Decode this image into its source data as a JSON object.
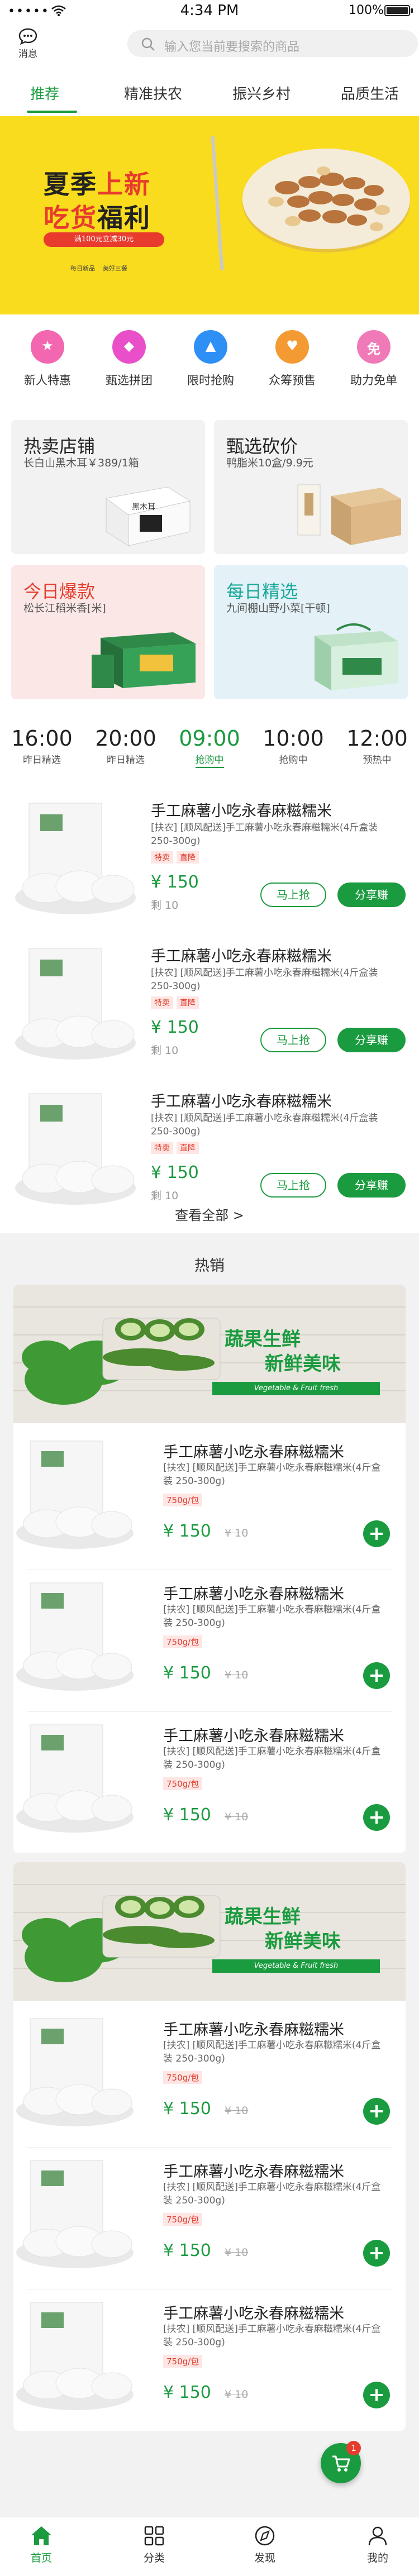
{
  "status_bar": {
    "carrier": "•••••",
    "time": "4:34 PM",
    "battery": "100%"
  },
  "header": {
    "message_label": "消息",
    "search_placeholder": "输入您当前要搜索的商品"
  },
  "tabs": [
    {
      "label": "推荐",
      "active": true
    },
    {
      "label": "精准扶农",
      "active": false
    },
    {
      "label": "振兴乡村",
      "active": false
    },
    {
      "label": "品质生活",
      "active": false
    }
  ],
  "banner": {
    "line1_a": "夏季",
    "line1_b": "上新",
    "line2_a": "吃货",
    "line2_b": "福利",
    "pill": "满100元立减30元",
    "foot_a": "每日新品",
    "foot_b": "美好三餐"
  },
  "quick_icons": [
    {
      "label": "新人特惠",
      "glyph": "🎁",
      "color": "#f267b0",
      "icon": "gift-icon"
    },
    {
      "label": "甄选拼团",
      "glyph": "🛍",
      "color": "#e84fc9",
      "icon": "shopping-bag-icon"
    },
    {
      "label": "限时抢购",
      "glyph": "🔥",
      "color": "#2e8ff5",
      "icon": "fire-icon"
    },
    {
      "label": "众筹预售",
      "glyph": "♥",
      "color": "#f39a33",
      "icon": "heart-hand-icon"
    },
    {
      "label": "助力免单",
      "glyph": "免",
      "color": "#f07ab7",
      "icon": "free-order-icon"
    }
  ],
  "promo_cards": [
    {
      "title": "热卖店铺",
      "subtitle": "长白山黑木耳￥389/1箱",
      "bg": "#f2f2f2"
    },
    {
      "title": "甄选砍价",
      "subtitle": "鸭脂米10盒/9.9元",
      "bg": "#f2f2f2"
    },
    {
      "title": "今日爆款",
      "subtitle": "松长江稻米香[米]",
      "bg": "#fbe8e6"
    },
    {
      "title": "每日精选",
      "subtitle": "九间棚山野小菜[干顿]",
      "bg": "#e4f2f7"
    }
  ],
  "flash_slots": [
    {
      "time": "16:00",
      "status": "昨日精选",
      "active": false
    },
    {
      "time": "20:00",
      "status": "昨日精选",
      "active": false
    },
    {
      "time": "09:00",
      "status": "抢购中",
      "active": true
    },
    {
      "time": "10:00",
      "status": "抢购中",
      "active": false
    },
    {
      "time": "12:00",
      "status": "预热中",
      "active": false
    }
  ],
  "flash_items": [
    {
      "name": "手工麻薯小吃永春麻糍糯米",
      "desc": "[扶农] [顺风配送]手工麻薯小吃永春麻糍糯米(4斤盒装 250-300g)",
      "tags": [
        "特卖",
        "直降"
      ],
      "price": "¥ 150",
      "remaining": "剩 10"
    },
    {
      "name": "手工麻薯小吃永春麻糍糯米",
      "desc": "[扶农] [顺风配送]手工麻薯小吃永春麻糍糯米(4斤盒装 250-300g)",
      "tags": [
        "特卖",
        "直降"
      ],
      "price": "¥ 150",
      "remaining": "剩 10"
    },
    {
      "name": "手工麻薯小吃永春麻糍糯米",
      "desc": "[扶农] [顺风配送]手工麻薯小吃永春麻糍糯米(4斤盒装 250-300g)",
      "tags": [
        "特卖",
        "直降"
      ],
      "price": "¥ 150",
      "remaining": "剩 10"
    }
  ],
  "buttons": {
    "grab": "马上抢",
    "share": "分享赚",
    "view_all": "查看全部 >"
  },
  "hot": {
    "title": "热销",
    "fresh_line1": "蔬果生鲜",
    "fresh_line2": "新鲜美味",
    "fresh_en": "Vegetable & Fruit fresh",
    "items": [
      {
        "name": "手工麻薯小吃永春麻糍糯米",
        "desc": "[扶农] [顺风配送]手工麻薯小吃永春麻糍糯米(4斤盒装 250-300g)",
        "unit": "750g/包",
        "price": "¥ 150",
        "old": "¥ 10"
      },
      {
        "name": "手工麻薯小吃永春麻糍糯米",
        "desc": "[扶农] [顺风配送]手工麻薯小吃永春麻糍糯米(4斤盒装 250-300g)",
        "unit": "750g/包",
        "price": "¥ 150",
        "old": "¥ 10"
      },
      {
        "name": "手工麻薯小吃永春麻糍糯米",
        "desc": "[扶农] [顺风配送]手工麻薯小吃永春麻糍糯米(4斤盒装 250-300g)",
        "unit": "750g/包",
        "price": "¥ 150",
        "old": "¥ 10"
      },
      {
        "name": "手工麻薯小吃永春麻糍糯米",
        "desc": "[扶农] [顺风配送]手工麻薯小吃永春麻糍糯米(4斤盒装 250-300g)",
        "unit": "750g/包",
        "price": "¥ 150",
        "old": "¥ 10"
      },
      {
        "name": "手工麻薯小吃永春麻糍糯米",
        "desc": "[扶农] [顺风配送]手工麻薯小吃永春麻糍糯米(4斤盒装 250-300g)",
        "unit": "750g/包",
        "price": "¥ 150",
        "old": "¥ 10"
      },
      {
        "name": "手工麻薯小吃永春麻糍糯米",
        "desc": "[扶农] [顺风配送]手工麻薯小吃永春麻糍糯米(4斤盒装 250-300g)",
        "unit": "750g/包",
        "price": "¥ 150",
        "old": "¥ 10"
      }
    ]
  },
  "cart_badge": "1",
  "bottom_nav": [
    {
      "label": "首页",
      "active": true,
      "icon": "home-icon"
    },
    {
      "label": "分类",
      "active": false,
      "icon": "category-icon"
    },
    {
      "label": "发现",
      "active": false,
      "icon": "compass-icon"
    },
    {
      "label": "我的",
      "active": false,
      "icon": "user-icon"
    }
  ],
  "colors": {
    "brand_green": "#1a9b3f",
    "accent_red": "#e43d2e",
    "banner_yellow": "#f9dc1e"
  }
}
